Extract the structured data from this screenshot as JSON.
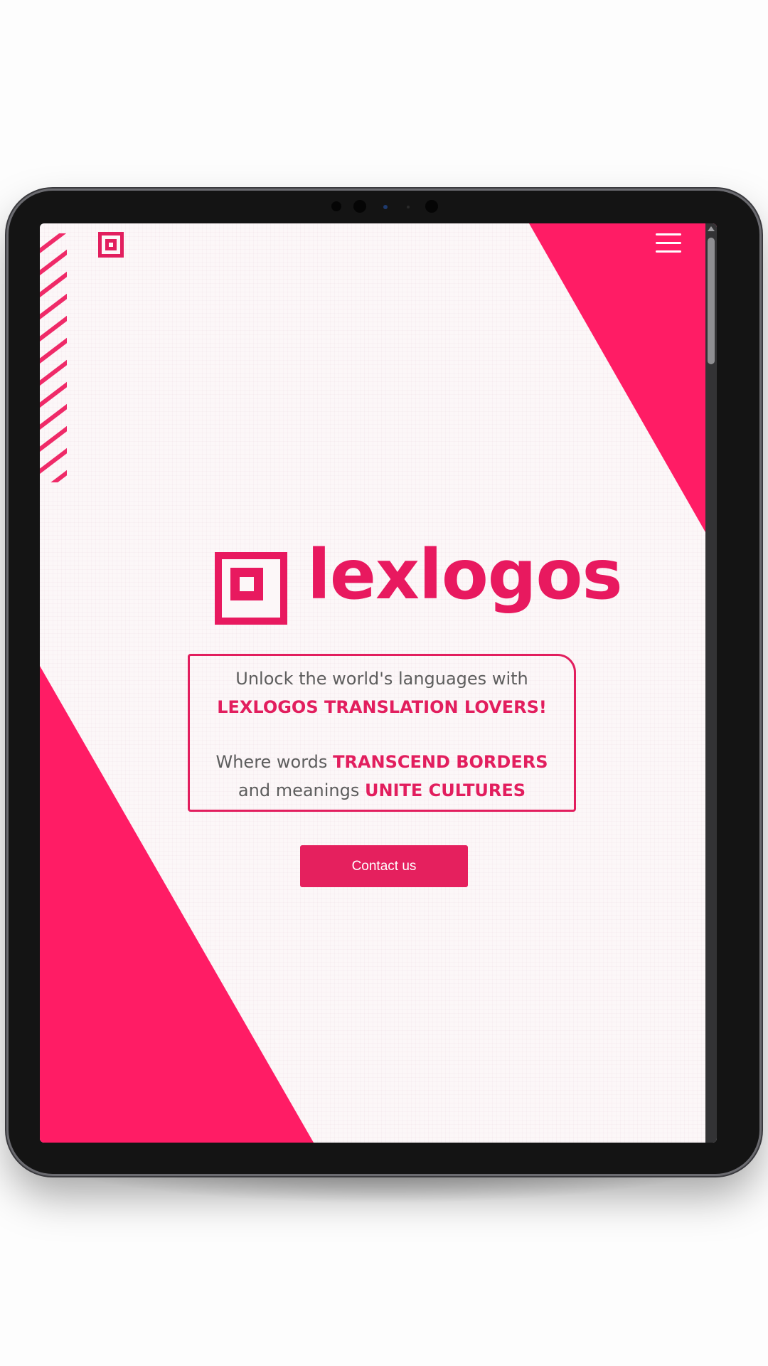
{
  "brand": {
    "name": "lexlogos",
    "accent_color": "#e8195f"
  },
  "header": {
    "logo_icon": "lexlogos-square-logo-icon",
    "menu_icon": "hamburger-menu-icon"
  },
  "hero": {
    "tagline": {
      "line1": "Unlock the world's languages with",
      "line2_highlight": "LEXLOGOS TRANSLATION LOVERS!",
      "line3_prefix": "Where words",
      "line3_highlight": "TRANSCEND BORDERS",
      "line4_prefix": "and meanings",
      "line4_highlight": "UNITE CULTURES"
    },
    "cta_label": "Contact us"
  },
  "colors": {
    "accent": "#e21e5e",
    "decor_pink": "#ff1c65",
    "device_frame": "#141414",
    "text_gray": "#5d5d5d"
  }
}
